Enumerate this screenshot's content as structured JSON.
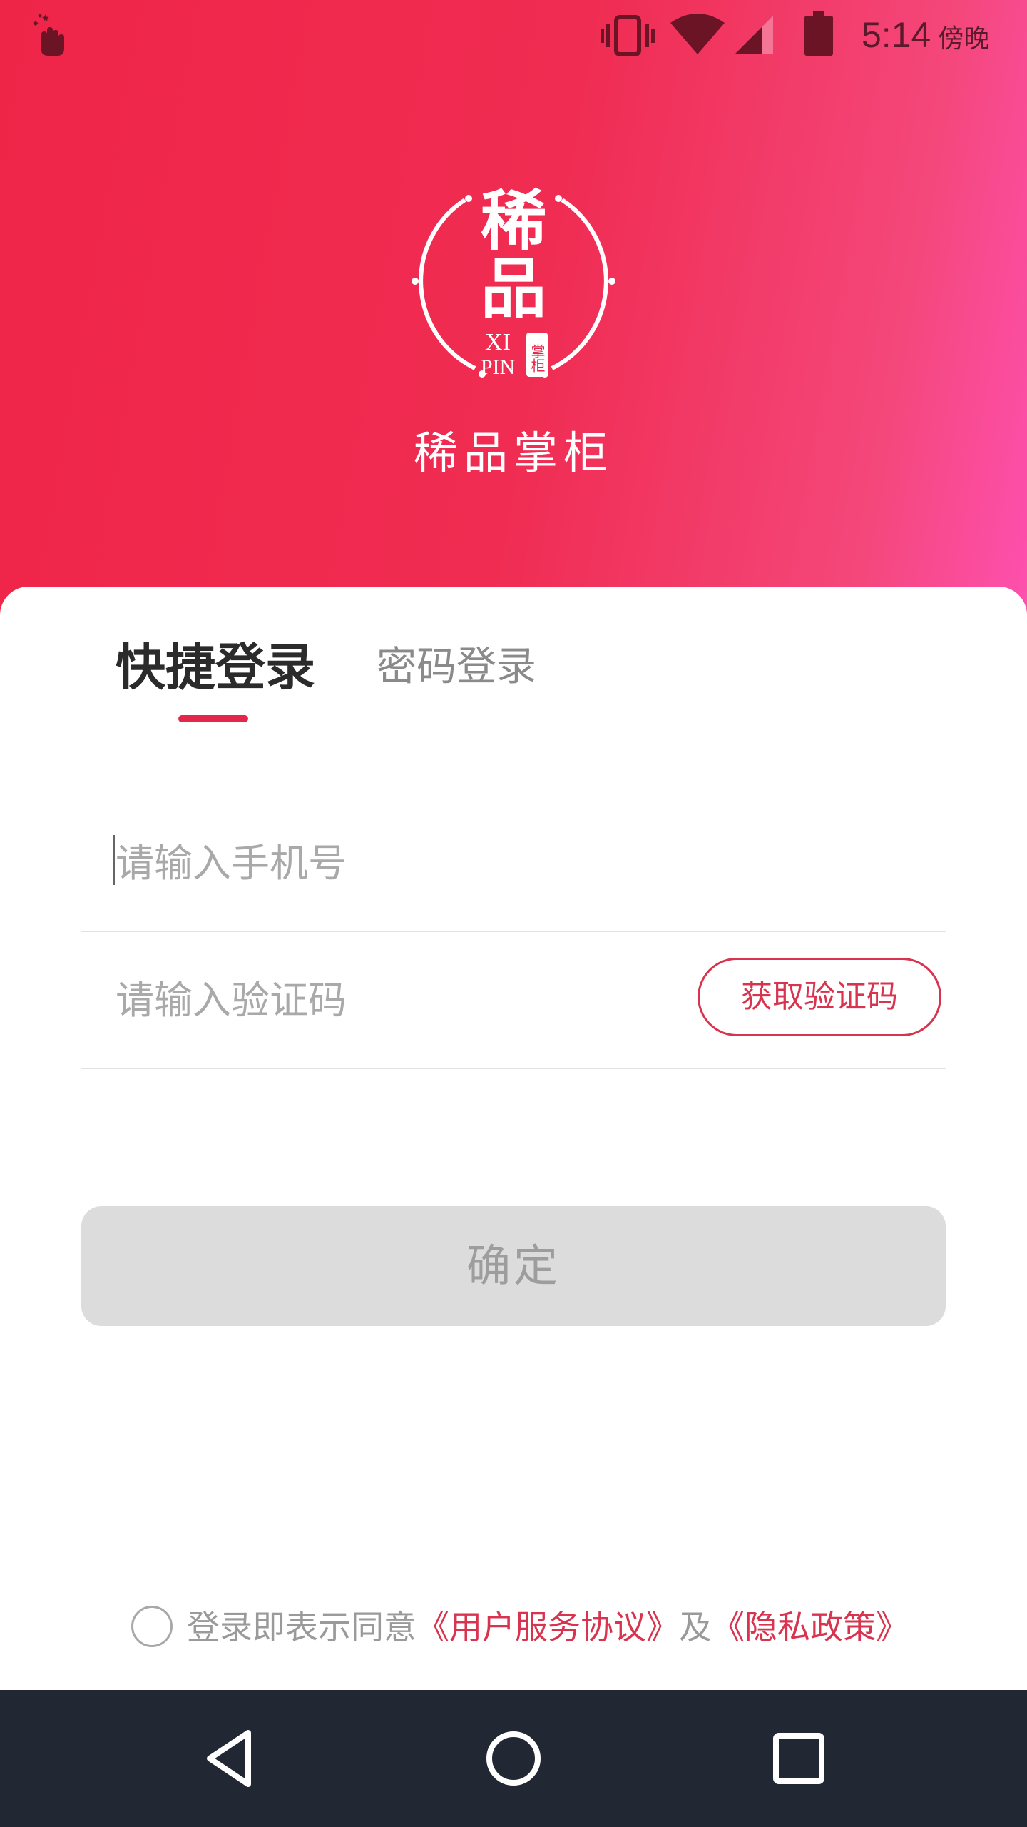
{
  "status_bar": {
    "time": "5:14",
    "ampm": "傍晚"
  },
  "brand": {
    "app_name": "稀品掌柜",
    "logo_text_1": "稀",
    "logo_text_2": "品",
    "logo_text_xi": "XI",
    "logo_text_pin": "PIN",
    "logo_seal": "掌柜"
  },
  "tabs": {
    "quick_login": "快捷登录",
    "password_login": "密码登录"
  },
  "form": {
    "phone_placeholder": "请输入手机号",
    "phone_value": "",
    "code_placeholder": "请输入验证码",
    "code_value": "",
    "get_code_label": "获取验证码",
    "confirm_label": "确定"
  },
  "agreement": {
    "prefix": "登录即表示同意",
    "user_agreement": "《用户服务协议》",
    "conjunction": "及",
    "privacy_policy": "《隐私政策》"
  },
  "colors": {
    "accent": "#e3264b",
    "header_start": "#ef2548",
    "header_end": "#fe50b0",
    "nav_bar": "#212833",
    "button_disabled": "#dcdcdc"
  },
  "icons": {
    "notification": "hand-heart-icon",
    "vibrate": "vibrate-icon",
    "wifi": "wifi-icon",
    "signal": "signal-icon",
    "battery": "battery-icon",
    "back": "back-triangle-icon",
    "home": "home-circle-icon",
    "recents": "recents-square-icon"
  }
}
